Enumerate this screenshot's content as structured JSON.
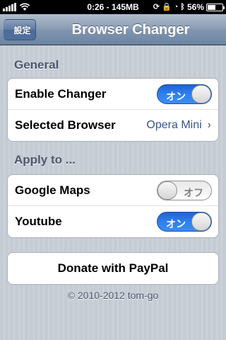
{
  "status_bar": {
    "time_memory": "0:26 - 145MB",
    "battery_percent": "56%",
    "battery_level": 0.56,
    "icons": [
      "signal-icon",
      "wifi-icon",
      "sync-icon",
      "rotation-lock-icon",
      "alarm-icon",
      "bluetooth-icon",
      "battery-icon"
    ]
  },
  "nav": {
    "back_label": "設定",
    "title": "Browser Changer"
  },
  "general": {
    "header": "General",
    "enable_changer_label": "Enable Changer",
    "enable_changer_state": "オン",
    "selected_browser_label": "Selected Browser",
    "selected_browser_value": "Opera Mini"
  },
  "apply_to": {
    "header": "Apply to ...",
    "google_maps_label": "Google Maps",
    "google_maps_state": "オフ",
    "youtube_label": "Youtube",
    "youtube_state": "オン"
  },
  "donate_label": "Donate with PayPal",
  "footer": "© 2010-2012 tom-go",
  "colors": {
    "toggle_on": "#2f7ff0",
    "nav_bar": "#6d84a2",
    "background": "#c5ccd4",
    "value_text": "#385487"
  }
}
